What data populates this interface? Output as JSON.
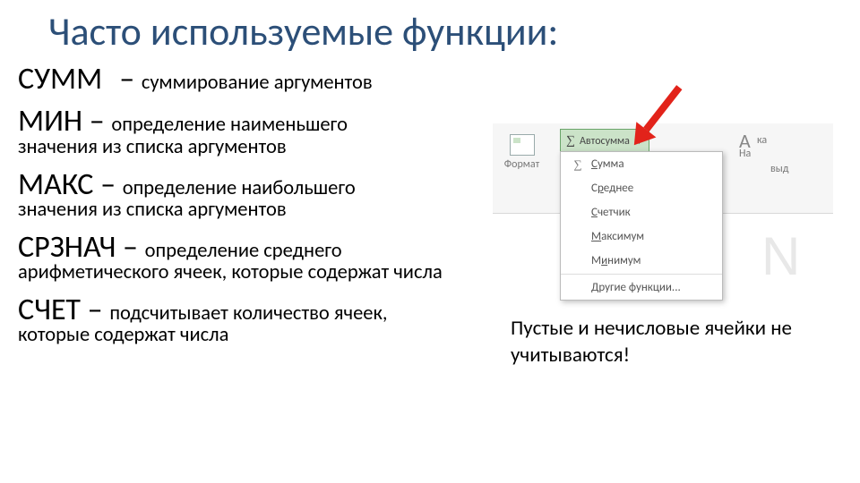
{
  "title": "Часто используемые функции:",
  "functions": [
    {
      "name": "СУММ",
      "dash": "– ",
      "desc": "суммирование аргументов",
      "desc2": ""
    },
    {
      "name": "МИН",
      "dash": " – ",
      "desc": "определение наименьшего",
      "desc2": "значения из списка аргументов"
    },
    {
      "name": "МАКС",
      "dash": " – ",
      "desc": "определение наибольшего",
      "desc2": "значения из списка аргументов"
    },
    {
      "name": "СРЗНАЧ",
      "dash": " – ",
      "desc": "определение среднего",
      "desc2": "арифметического ячеек, которые содержат числа"
    },
    {
      "name": "СЧЕТ",
      "dash": " – ",
      "desc": "подсчитывает количество ячеек,",
      "desc2": "которые содержат числа"
    }
  ],
  "note": "Пустые и нечисловые ячейки не учитываются!",
  "excel": {
    "format": "Формат",
    "autosum": "Автосумма",
    "right1": "ка",
    "right2": "На",
    "right3": "выд",
    "menu": {
      "sum": "Сумма",
      "avg": "Среднее",
      "count": "Счетчик",
      "max": "Максимум",
      "min": "Минимум",
      "other": "Другие функции..."
    },
    "bgletter": "N"
  }
}
